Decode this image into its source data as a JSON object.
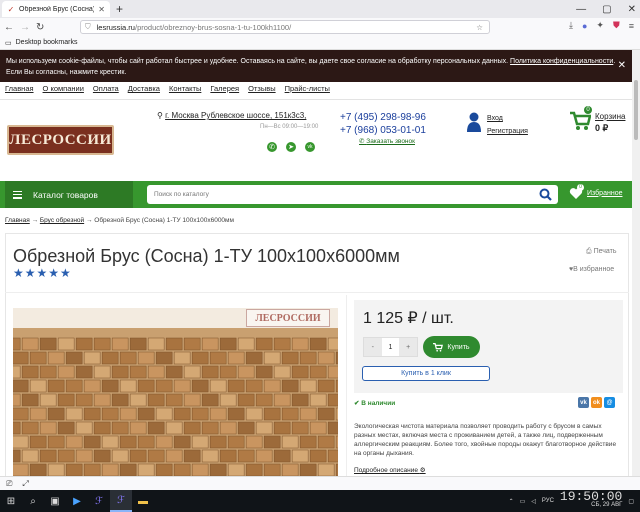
{
  "browser": {
    "tab_title": "Обрезной Брус (Сосна) 1-ТУ 1",
    "url_host": "lesrussia.ru",
    "url_path": "/product/obreznoy-brus-sosna-1-tu-100kh1100/",
    "bookmark": "Desktop bookmarks"
  },
  "cookie": {
    "text": "Мы используем cookie-файлы, чтобы сайт работал быстрее и удобнее. Оставаясь на сайте, вы даете свое согласие на обработку персональных данных.",
    "link": "Политика конфиденциальности",
    "text_after": ". Если Вы согласны, нажмите крестик."
  },
  "topmenu": [
    "Главная",
    "О компании",
    "Оплата",
    "Доставка",
    "Контакты",
    "Галерея",
    "Отзывы",
    "Прайс-листы"
  ],
  "header": {
    "logo": "ЛЕСРОССИИ",
    "address": "г. Москва Рублевское шоссе, 151к3с3,",
    "hours": "Пн—Вс 09:00—19:00",
    "phone1": "+7 (495) 298-98-96",
    "phone2": "+7 (968) 053-01-01",
    "callback": "Заказать звонок",
    "login": "Вход",
    "register": "Регистрация",
    "cart_label": "Корзина",
    "cart_sum": "0 ₽",
    "cart_count": "0"
  },
  "bar": {
    "catalog": "Каталог товаров",
    "search_placeholder": "Поиск по каталогу",
    "favorites": "Избранное",
    "fav_count": "0"
  },
  "breadcrumb": {
    "home": "Главная",
    "sep": "→",
    "category": "Брус обрезной",
    "current": "Обрезной Брус (Сосна) 1-ТУ 100х100х6000мм"
  },
  "product": {
    "title": "Обрезной Брус (Сосна) 1-ТУ 100х100х6000мм",
    "stars": "★★★★★",
    "print": "Печать",
    "wishlist": "В избранное",
    "watermark": "ЛЕСРОССИИ",
    "price": "1 125 ₽ / шт.",
    "qty": "1",
    "minus": "-",
    "plus": "+",
    "buy": "Купить",
    "oneclick": "Купить в 1 клик",
    "stock": "В наличии",
    "description": "Экологическая чистота материала позволяет проводить работу с брусом в самых разных местах, включая места с проживанием детей, а также лиц, подверженным аллергическим реакциям. Более того, хвойные породы окажут благотворное действие на органы дыхания.",
    "more": "Подробное описание"
  },
  "taskbar": {
    "lang": "РУС",
    "time": "19:50:00",
    "date": "СБ, 29 АВГ"
  }
}
